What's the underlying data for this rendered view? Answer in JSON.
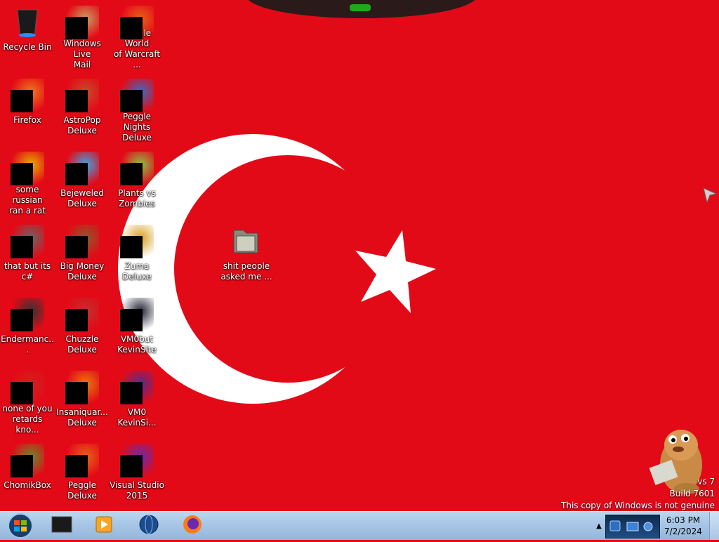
{
  "desktop_icons": [
    {
      "label": "Recycle Bin",
      "icon": "recycle-bin-icon"
    },
    {
      "label": "Windows Live\nMail",
      "icon": "mail-icon"
    },
    {
      "label": "Peggle World\nof Warcraft ...",
      "icon": "peggle-icon"
    },
    {
      "label": "Firefox",
      "icon": "firefox-icon"
    },
    {
      "label": "AstroPop\nDeluxe",
      "icon": "astropop-icon"
    },
    {
      "label": "Peggle Nights\nDeluxe",
      "icon": "peggle-nights-icon"
    },
    {
      "label": "some russian\nran a rat",
      "icon": "app-icon"
    },
    {
      "label": "Bejeweled\nDeluxe",
      "icon": "bejeweled-icon"
    },
    {
      "label": "Plants vs\nZombies",
      "icon": "plants-vs-zombies-icon"
    },
    {
      "label": "that but its c#",
      "icon": "window-stack-icon"
    },
    {
      "label": "Big Money\nDeluxe",
      "icon": "money-bag-icon"
    },
    {
      "label": "Zuma Deluxe",
      "icon": "zuma-icon"
    },
    {
      "label": "Endermanc...",
      "icon": "terminal-icon"
    },
    {
      "label": "Chuzzle\nDeluxe",
      "icon": "chuzzle-icon"
    },
    {
      "label": "VM0but\nKevinSite",
      "icon": "monitor-icon"
    },
    {
      "label": "none of you\nretards kno...",
      "icon": "red-circle-icon"
    },
    {
      "label": "Insaniquar...\nDeluxe",
      "icon": "fish-icon"
    },
    {
      "label": "VM0\nKevinSi...",
      "icon": "vm-icon"
    },
    {
      "label": "ChomikBox",
      "icon": "chomikbox-icon"
    },
    {
      "label": "Peggle Deluxe",
      "icon": "peggle-deluxe-icon"
    },
    {
      "label": "Visual Studio\n2015",
      "icon": "visual-studio-icon"
    },
    {
      "label": "shit people\nasked me ...",
      "icon": "folder-icon"
    }
  ],
  "watermark": {
    "line1": "vs 7",
    "line2": "Build 7601",
    "line3": "This copy of Windows is not genuine"
  },
  "taskbar": {
    "pinned": [
      {
        "name": "terminal-icon"
      },
      {
        "name": "media-player-icon"
      },
      {
        "name": "globe-icon"
      },
      {
        "name": "firefox-icon"
      }
    ],
    "clock_time": "6:03 PM",
    "clock_date": "7/2/2024",
    "tray_expand": "▲"
  },
  "colors": {
    "flag_red": "#e30a17",
    "flag_white": "#ffffff",
    "taskbar": "#a7c6e6"
  }
}
